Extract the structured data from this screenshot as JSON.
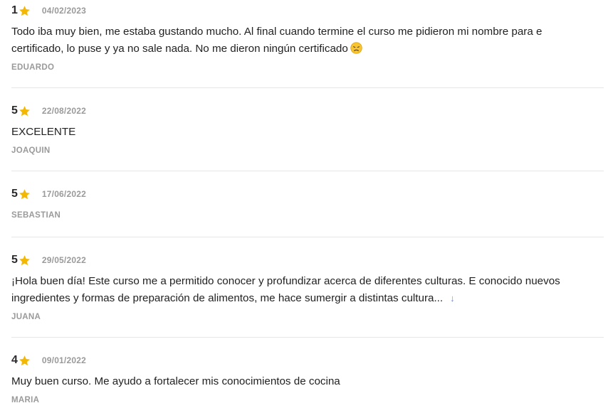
{
  "colors": {
    "star": "#f5b800",
    "date": "#9a9a9a",
    "author": "#9a9a9a",
    "divider": "#e6e6e6",
    "expand_arrow": "#6e8fd6"
  },
  "reviews": [
    {
      "rating": "1",
      "date": "04/02/2023",
      "text": "Todo iba muy bien, me estaba gustando mucho. Al final cuando termine el curso me pidieron mi nombre para e certificado, lo puse y ya no sale nada. No me dieron ningún certificado",
      "emoji": "disappointed-face-icon",
      "author": "EDUARDO"
    },
    {
      "rating": "5",
      "date": "22/08/2022",
      "text": "EXCELENTE",
      "author": "JOAQUIN"
    },
    {
      "rating": "5",
      "date": "17/06/2022",
      "text": "",
      "author": "SEBASTIAN"
    },
    {
      "rating": "5",
      "date": "29/05/2022",
      "text": "¡Hola buen día! Este curso me a permitido conocer y profundizar acerca de diferentes culturas. E conocido nuevos ingredientes y formas de preparación de alimentos, me hace sumergir a distintas cultura...",
      "expand_icon": "arrow-down-icon",
      "author": "JUANA"
    },
    {
      "rating": "4",
      "date": "09/01/2022",
      "text": "Muy buen curso. Me ayudo a fortalecer mis conocimientos de cocina",
      "author": "MARIA"
    }
  ]
}
